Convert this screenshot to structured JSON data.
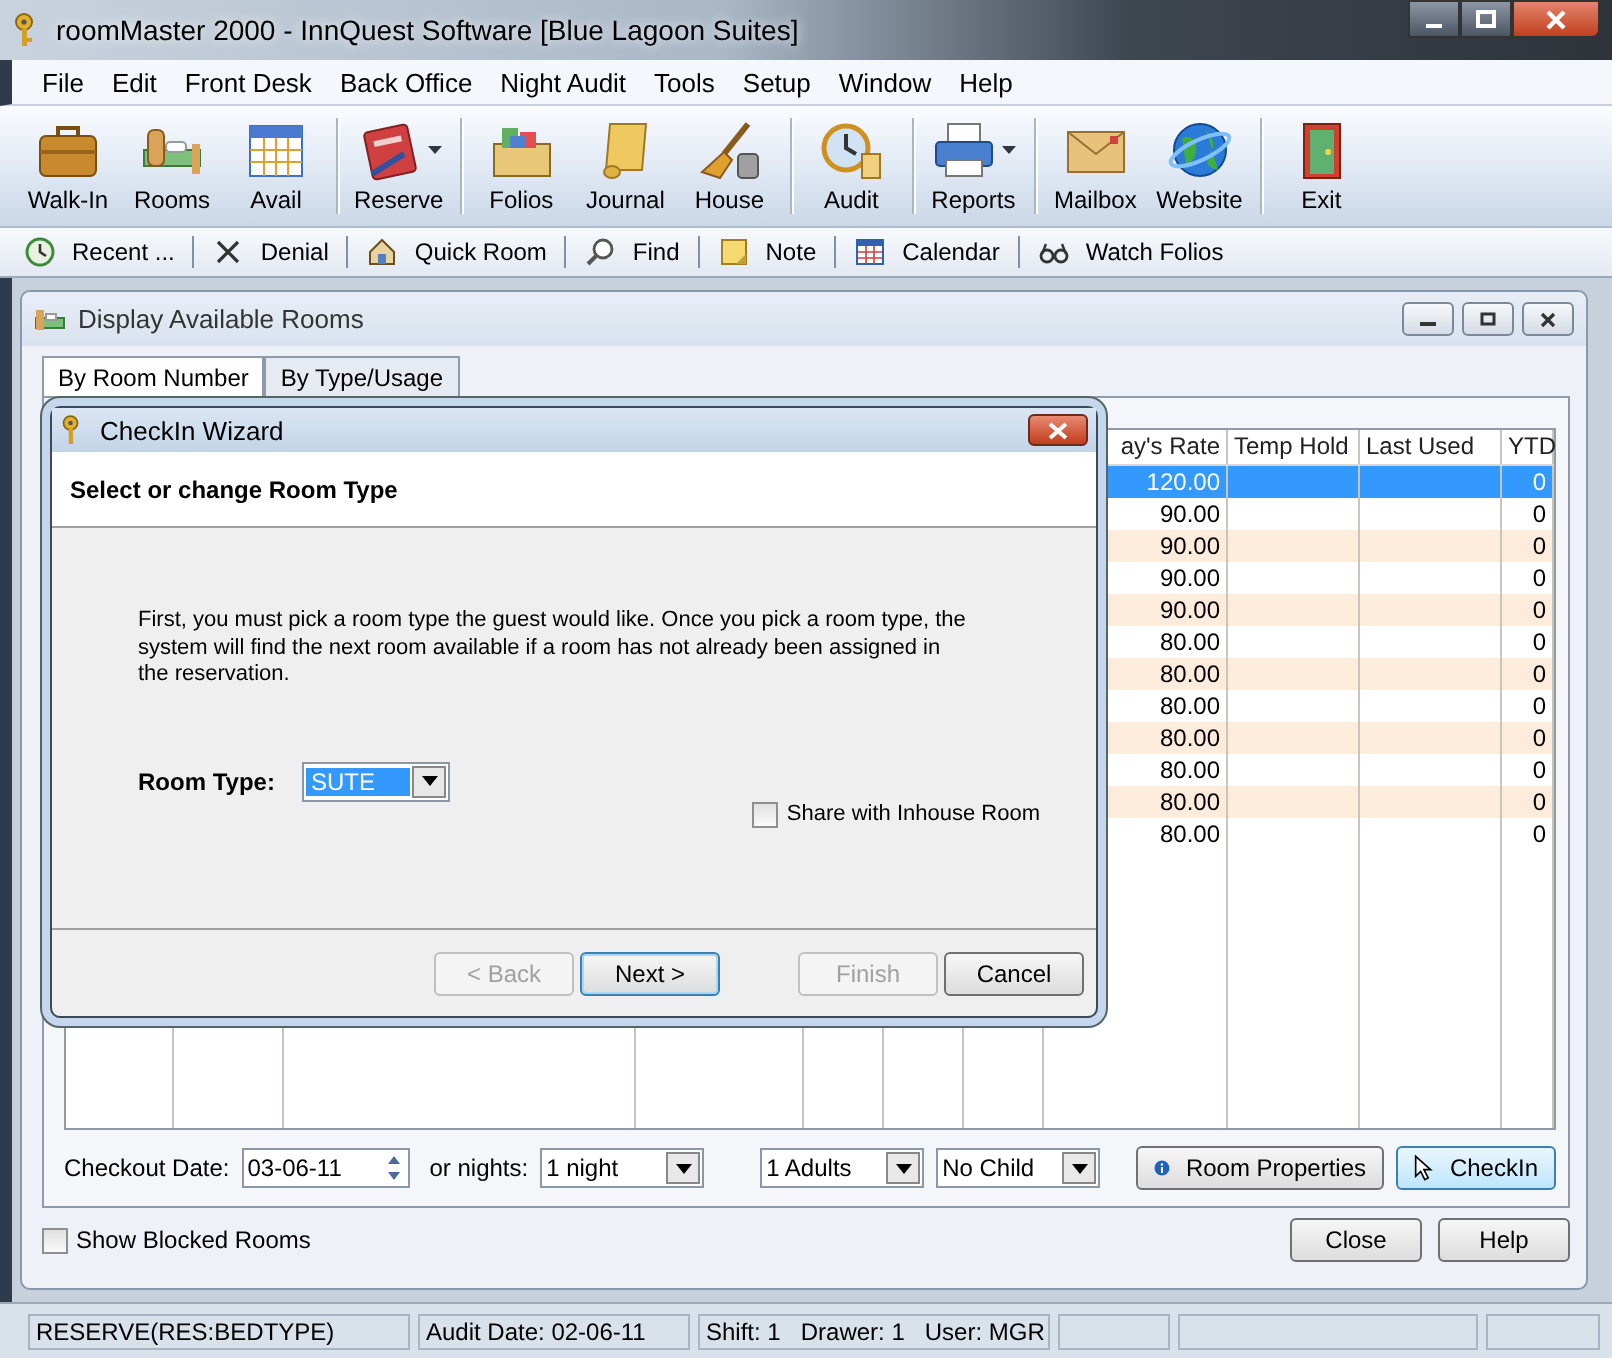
{
  "window": {
    "title": "roomMaster 2000 - InnQuest Software [Blue Lagoon Suites]"
  },
  "menu": [
    "File",
    "Edit",
    "Front Desk",
    "Back Office",
    "Night Audit",
    "Tools",
    "Setup",
    "Window",
    "Help"
  ],
  "toolbar_groups": [
    [
      {
        "label": "Walk-In",
        "dropdown": false
      },
      {
        "label": "Rooms",
        "dropdown": false
      },
      {
        "label": "Avail",
        "dropdown": false
      }
    ],
    [
      {
        "label": "Reserve",
        "dropdown": true
      }
    ],
    [
      {
        "label": "Folios",
        "dropdown": false
      },
      {
        "label": "Journal",
        "dropdown": false
      },
      {
        "label": "House",
        "dropdown": false
      }
    ],
    [
      {
        "label": "Audit",
        "dropdown": false
      }
    ],
    [
      {
        "label": "Reports",
        "dropdown": true
      }
    ],
    [
      {
        "label": "Mailbox",
        "dropdown": false
      },
      {
        "label": "Website",
        "dropdown": false
      }
    ],
    [
      {
        "label": "Exit",
        "dropdown": false
      }
    ]
  ],
  "quickbar": [
    "Recent ...",
    "Denial",
    "Quick Room",
    "Find",
    "Note",
    "Calendar",
    "Watch Folios"
  ],
  "rooms_window": {
    "title": "Display Available Rooms",
    "tabs": [
      {
        "label": "By Room Number",
        "selected": true
      },
      {
        "label": "By Type/Usage",
        "selected": false
      }
    ],
    "columns": [
      "ay's Rate",
      "Temp Hold",
      "Last Used",
      "YTD"
    ],
    "rows": [
      {
        "rate": "120.00",
        "ytd": "0",
        "selected": true
      },
      {
        "rate": "90.00",
        "ytd": "0",
        "selected": false
      },
      {
        "rate": "90.00",
        "ytd": "0",
        "selected": false
      },
      {
        "rate": "90.00",
        "ytd": "0",
        "selected": false
      },
      {
        "rate": "90.00",
        "ytd": "0",
        "selected": false
      },
      {
        "rate": "80.00",
        "ytd": "0",
        "selected": false
      },
      {
        "rate": "80.00",
        "ytd": "0",
        "selected": false
      },
      {
        "rate": "80.00",
        "ytd": "0",
        "selected": false
      },
      {
        "rate": "80.00",
        "ytd": "0",
        "selected": false
      },
      {
        "rate": "80.00",
        "ytd": "0",
        "selected": false
      },
      {
        "rate": "80.00",
        "ytd": "0",
        "selected": false
      },
      {
        "rate": "80.00",
        "ytd": "0",
        "selected": false
      }
    ],
    "checkout_date": {
      "label": "Checkout Date:",
      "value": "03-06-11"
    },
    "nights": {
      "label": "or nights:",
      "value": "1 night"
    },
    "adults": "1 Adults",
    "children": "No Child",
    "room_properties": "Room Properties",
    "checkin": "CheckIn",
    "show_blocked": {
      "label": "Show Blocked Rooms",
      "checked": false
    },
    "close": "Close",
    "help": "Help"
  },
  "dialog": {
    "title": "CheckIn Wizard",
    "heading": "Select or change Room Type",
    "text": "First, you must pick a room type the guest would like.  Once you pick a room type, the system will find the next room available if a room has not already been assigned in the reservation.",
    "room_type": {
      "label": "Room Type:",
      "value": "SUTE"
    },
    "share": {
      "label": "Share with Inhouse Room",
      "checked": false
    },
    "buttons": [
      {
        "label": "< Back",
        "disabled": true,
        "default": false
      },
      {
        "label": "Next >",
        "disabled": false,
        "default": true
      },
      {
        "label": "Finish",
        "disabled": true,
        "default": false
      },
      {
        "label": "Cancel",
        "disabled": false,
        "default": false
      }
    ]
  },
  "status_bar": [
    "RESERVE(RES:BEDTYPE)",
    "Audit Date: 02-06-11",
    "Shift: 1   Drawer: 1   User: MGR"
  ]
}
